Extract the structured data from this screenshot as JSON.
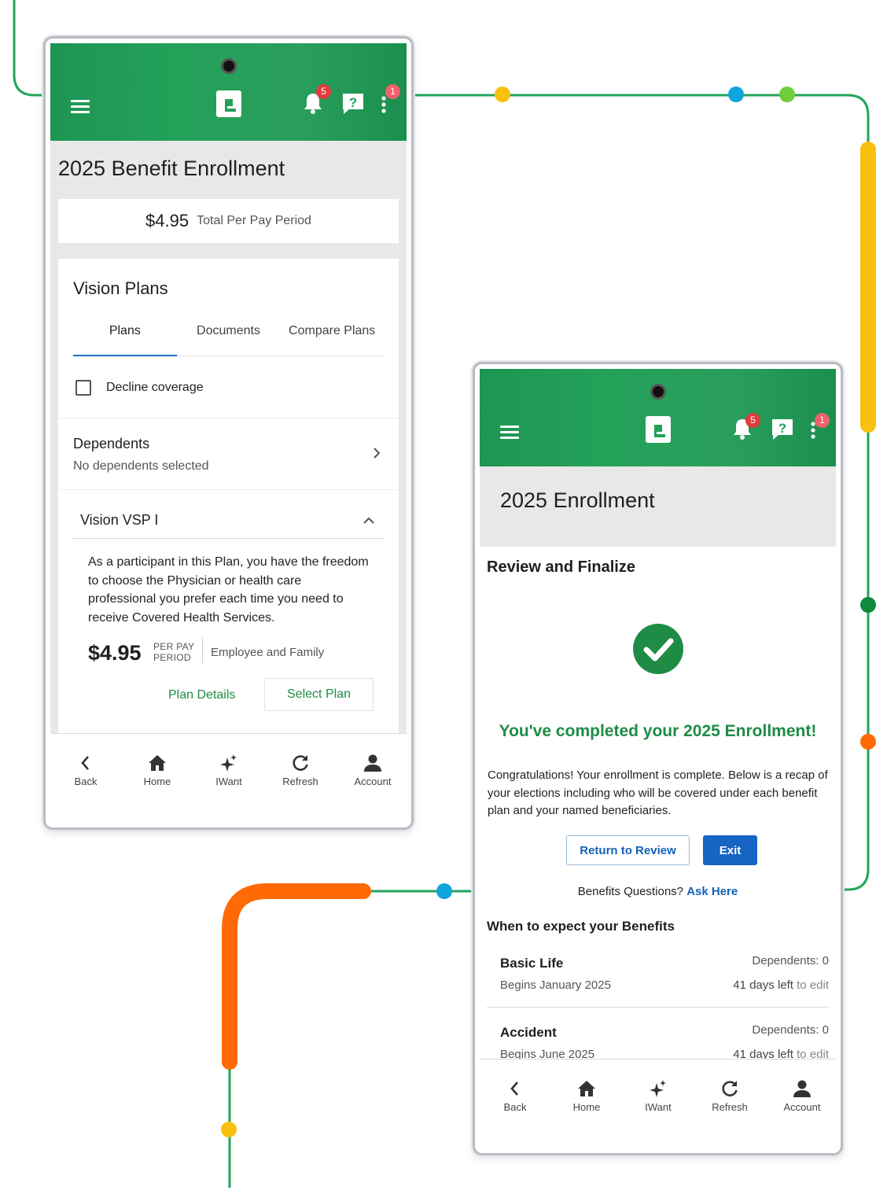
{
  "colors": {
    "brand_green": "#22a059",
    "accent_blue": "#1664c4",
    "badge_red": "#e03c3c",
    "track_green": "#22a55b",
    "track_yellow": "#f9c00d",
    "track_orange": "#ff6a06",
    "track_blue": "#0ea5dc",
    "track_lime": "#6fcc3c",
    "track_dark_green": "#0f8a3d"
  },
  "app_bar": {
    "menu_icon": "hamburger-menu-icon",
    "logo_icon": "paycom-logo-icon",
    "notifications_icon": "bell-icon",
    "notifications_count": "5",
    "help_icon": "help-chat-icon",
    "more_icon": "more-vertical-icon",
    "more_count": "1"
  },
  "bottom_nav": [
    {
      "label": "Back",
      "icon": "chevron-left-icon"
    },
    {
      "label": "Home",
      "icon": "home-icon"
    },
    {
      "label": "IWant",
      "icon": "sparkle-icon"
    },
    {
      "label": "Refresh",
      "icon": "refresh-icon"
    },
    {
      "label": "Account",
      "icon": "person-icon"
    }
  ],
  "screen1": {
    "title": "2025 Benefit Enrollment",
    "total": {
      "amount": "$4.95",
      "label": "Total Per Pay Period"
    },
    "section_title": "Vision Plans",
    "tabs": [
      "Plans",
      "Documents",
      "Compare Plans"
    ],
    "active_tab": "Plans",
    "decline": {
      "label": "Decline coverage",
      "checked": false
    },
    "dependents": {
      "title": "Dependents",
      "subtitle": "No dependents selected"
    },
    "plan": {
      "name": "Vision VSP I",
      "expanded": true,
      "description": "As a participant in this Plan, you have the freedom to choose the Physician or health care professional you prefer each time you need to receive Covered Health Services.",
      "price": "$4.95",
      "per_line1": "PER PAY",
      "per_line2": "PERIOD",
      "coverage": "Employee and Family",
      "details_label": "Plan Details",
      "select_label": "Select Plan"
    }
  },
  "screen2": {
    "title": "2025 Enrollment",
    "section_title": "Review and Finalize",
    "success_icon": "check-circle-icon",
    "success_message": "You've completed your 2025 Enrollment!",
    "congrats": "Congratulations! Your enrollment is complete. Below is a recap of your elections including who will be covered under each benefit plan and your named beneficiaries.",
    "return_label": "Return to Review",
    "exit_label": "Exit",
    "questions_text": "Benefits Questions?",
    "questions_link": "Ask Here",
    "expect_title": "When to expect your Benefits",
    "benefits": [
      {
        "name": "Basic Life",
        "begins": "Begins January 2025",
        "dependents_label": "Dependents:",
        "dependents_value": "0",
        "days_left": "41 days left",
        "to_edit": "to edit"
      },
      {
        "name": "Accident",
        "begins": "Begins June 2025",
        "dependents_label": "Dependents:",
        "dependents_value": "0",
        "days_left": "41 days left",
        "to_edit": "to edit"
      }
    ]
  }
}
